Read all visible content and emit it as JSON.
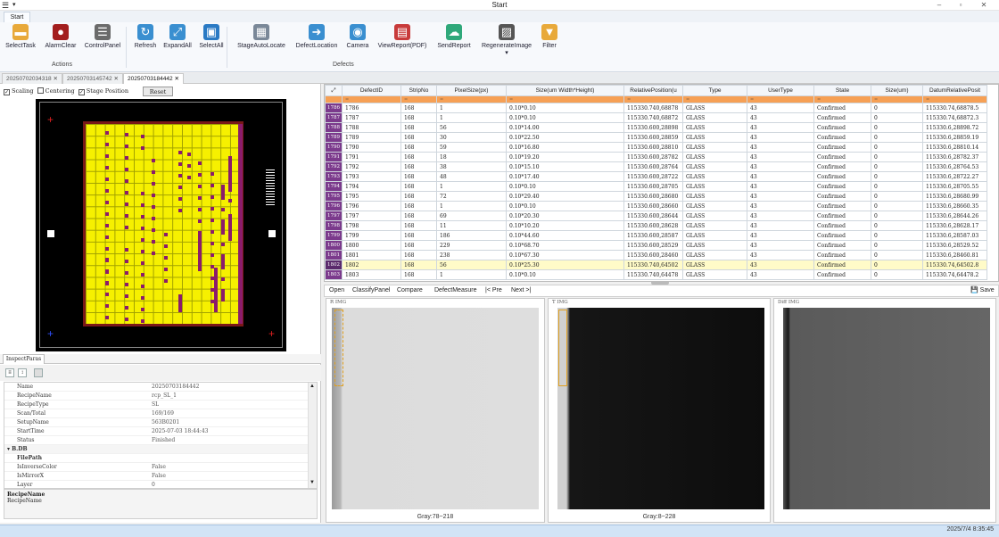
{
  "window": {
    "title": "Start",
    "menu_icon": "hamburger-icon",
    "minimize": "–",
    "maximize": "▫",
    "close": "✕"
  },
  "ribbon": {
    "tab": "Start",
    "groups": {
      "actions": "Actions",
      "defects": "Defects"
    },
    "buttons": [
      {
        "label": "SelectTask",
        "icon": "folder-icon",
        "color": "#e8a93a"
      },
      {
        "label": "AlarmClear",
        "icon": "alarm-icon",
        "color": "#a31e1e"
      },
      {
        "label": "ControlPanel",
        "icon": "list-panel-icon",
        "color": "#6b6b6b"
      },
      {
        "label": "Refresh",
        "icon": "refresh-icon",
        "color": "#3a8fd0"
      },
      {
        "label": "ExpandAll",
        "icon": "expand-icon",
        "color": "#3a8fd0"
      },
      {
        "label": "SelectAll",
        "icon": "select-all-icon",
        "color": "#2a7ac4"
      },
      {
        "label": "StageAutoLocate",
        "icon": "stage-locate-icon",
        "color": "#7a8898"
      },
      {
        "label": "DefectLocation",
        "icon": "defect-location-icon",
        "color": "#3a8fd0"
      },
      {
        "label": "Camera",
        "icon": "camera-eye-icon",
        "color": "#3a8fd0"
      },
      {
        "label": "ViewReport(PDF)",
        "icon": "pdf-icon",
        "color": "#c83b3b"
      },
      {
        "label": "SendReport",
        "icon": "cloud-upload-icon",
        "color": "#2fa87a"
      },
      {
        "label": "RegenerateImage",
        "icon": "regenerate-image-icon",
        "color": "#555"
      },
      {
        "label": "Filter",
        "icon": "filter-icon",
        "color": "#e8a93a"
      }
    ]
  },
  "doc_tabs": [
    "20250702034318",
    "20250703145742",
    "20250703184442"
  ],
  "stage_options": {
    "scaling": "Scaling",
    "centering": "Centering",
    "stage_position": "Stage Position",
    "reset": "Reset"
  },
  "inspect": {
    "tab": "InspectParas",
    "rows": [
      {
        "k": "Name",
        "v": "20250703184442"
      },
      {
        "k": "RecipeName",
        "v": "rcp_SL_1"
      },
      {
        "k": "RecipeType",
        "v": "SL"
      },
      {
        "k": "Scan/Total",
        "v": "169/169"
      },
      {
        "k": "SetupName",
        "v": "563B0201"
      },
      {
        "k": "StartTime",
        "v": "2025-07-03 18:44:43"
      },
      {
        "k": "Status",
        "v": "Finished"
      },
      {
        "k": "B.DB",
        "v": "",
        "cat": true
      },
      {
        "k": "FilePath",
        "v": "",
        "bold": true
      },
      {
        "k": "IsInverseColor",
        "v": "False"
      },
      {
        "k": "IsMirrorX",
        "v": "False"
      },
      {
        "k": "Layer",
        "v": "0"
      }
    ],
    "desc_title": "RecipeName",
    "desc_text": "RecipeName"
  },
  "table": {
    "headers": [
      "DefectID",
      "StripNo",
      "PixelSize(px)",
      "Size(um Width*Height)",
      "RelativePosition(u",
      "Type",
      "UserType",
      "State",
      "Size(um)",
      "DatumRelativePosit"
    ],
    "filter_mark": "=",
    "rows": [
      [
        "1786",
        "168",
        "1",
        "0.10*0.10",
        "115330.740,68878",
        "GLASS",
        "43",
        "Confirmed",
        "0",
        "115330.74,68878.5"
      ],
      [
        "1787",
        "168",
        "1",
        "0.10*0.10",
        "115330.740,68872",
        "GLASS",
        "43",
        "Confirmed",
        "0",
        "115330.74,68872.3"
      ],
      [
        "1788",
        "168",
        "56",
        "0.10*14.00",
        "115330.600,28898",
        "GLASS",
        "43",
        "Confirmed",
        "0",
        "115330.6,28898.72"
      ],
      [
        "1789",
        "168",
        "30",
        "0.10*22.50",
        "115330.600,28859",
        "GLASS",
        "43",
        "Confirmed",
        "0",
        "115330.6,28859.19"
      ],
      [
        "1790",
        "168",
        "59",
        "0.10*16.80",
        "115330.600,28810",
        "GLASS",
        "43",
        "Confirmed",
        "0",
        "115330.6,28810.14"
      ],
      [
        "1791",
        "168",
        "18",
        "0.10*19.20",
        "115330.600,28782",
        "GLASS",
        "43",
        "Confirmed",
        "0",
        "115330.6,28782.37"
      ],
      [
        "1792",
        "168",
        "38",
        "0.10*15.10",
        "115330.600,28764",
        "GLASS",
        "43",
        "Confirmed",
        "0",
        "115330.6,28764.53"
      ],
      [
        "1793",
        "168",
        "48",
        "0.10*17.40",
        "115330.600,28722",
        "GLASS",
        "43",
        "Confirmed",
        "0",
        "115330.6,28722.27"
      ],
      [
        "1794",
        "168",
        "1",
        "0.10*0.10",
        "115330.600,28705",
        "GLASS",
        "43",
        "Confirmed",
        "0",
        "115330.6,28705.55"
      ],
      [
        "1795",
        "168",
        "72",
        "0.10*29.40",
        "115330.600,28680",
        "GLASS",
        "43",
        "Confirmed",
        "0",
        "115330.6,28680.99"
      ],
      [
        "1796",
        "168",
        "1",
        "0.10*0.10",
        "115330.600,28660",
        "GLASS",
        "43",
        "Confirmed",
        "0",
        "115330.6,28660.35"
      ],
      [
        "1797",
        "168",
        "69",
        "0.10*20.30",
        "115330.600,28644",
        "GLASS",
        "43",
        "Confirmed",
        "0",
        "115330.6,28644.26"
      ],
      [
        "1798",
        "168",
        "11",
        "0.10*10.20",
        "115330.600,28628",
        "GLASS",
        "43",
        "Confirmed",
        "0",
        "115330.6,28628.17"
      ],
      [
        "1799",
        "168",
        "186",
        "0.10*44.60",
        "115330.600,28587",
        "GLASS",
        "43",
        "Confirmed",
        "0",
        "115330.6,28587.03"
      ],
      [
        "1800",
        "168",
        "229",
        "0.10*68.70",
        "115330.600,28529",
        "GLASS",
        "43",
        "Confirmed",
        "0",
        "115330.6,28529.52"
      ],
      [
        "1801",
        "168",
        "238",
        "0.10*67.30",
        "115330.600,28460",
        "GLASS",
        "43",
        "Confirmed",
        "0",
        "115330.6,28460.81"
      ],
      [
        "1802",
        "168",
        "56",
        "0.10*25.30",
        "115330.740,64502",
        "GLASS",
        "43",
        "Confirmed",
        "0",
        "115330.74,64502.8"
      ],
      [
        "1803",
        "168",
        "1",
        "0.10*0.10",
        "115330.740,64478",
        "GLASS",
        "43",
        "Confirmed",
        "0",
        "115330.74,64478.2"
      ]
    ]
  },
  "image_toolbar": {
    "open": "Open",
    "classify": "ClassifyPanel",
    "compare": "Compare",
    "measure": "DefectMeasure",
    "prev": "Pre",
    "next": "Next",
    "save": "Save"
  },
  "images": [
    {
      "label": "R IMG",
      "gray": "Gray:78~218"
    },
    {
      "label": "T IMG",
      "gray": "Gray:8~228"
    },
    {
      "label": "Diff IMG",
      "gray": ""
    }
  ],
  "status": {
    "time": "2025/7/4 8:35:45"
  }
}
